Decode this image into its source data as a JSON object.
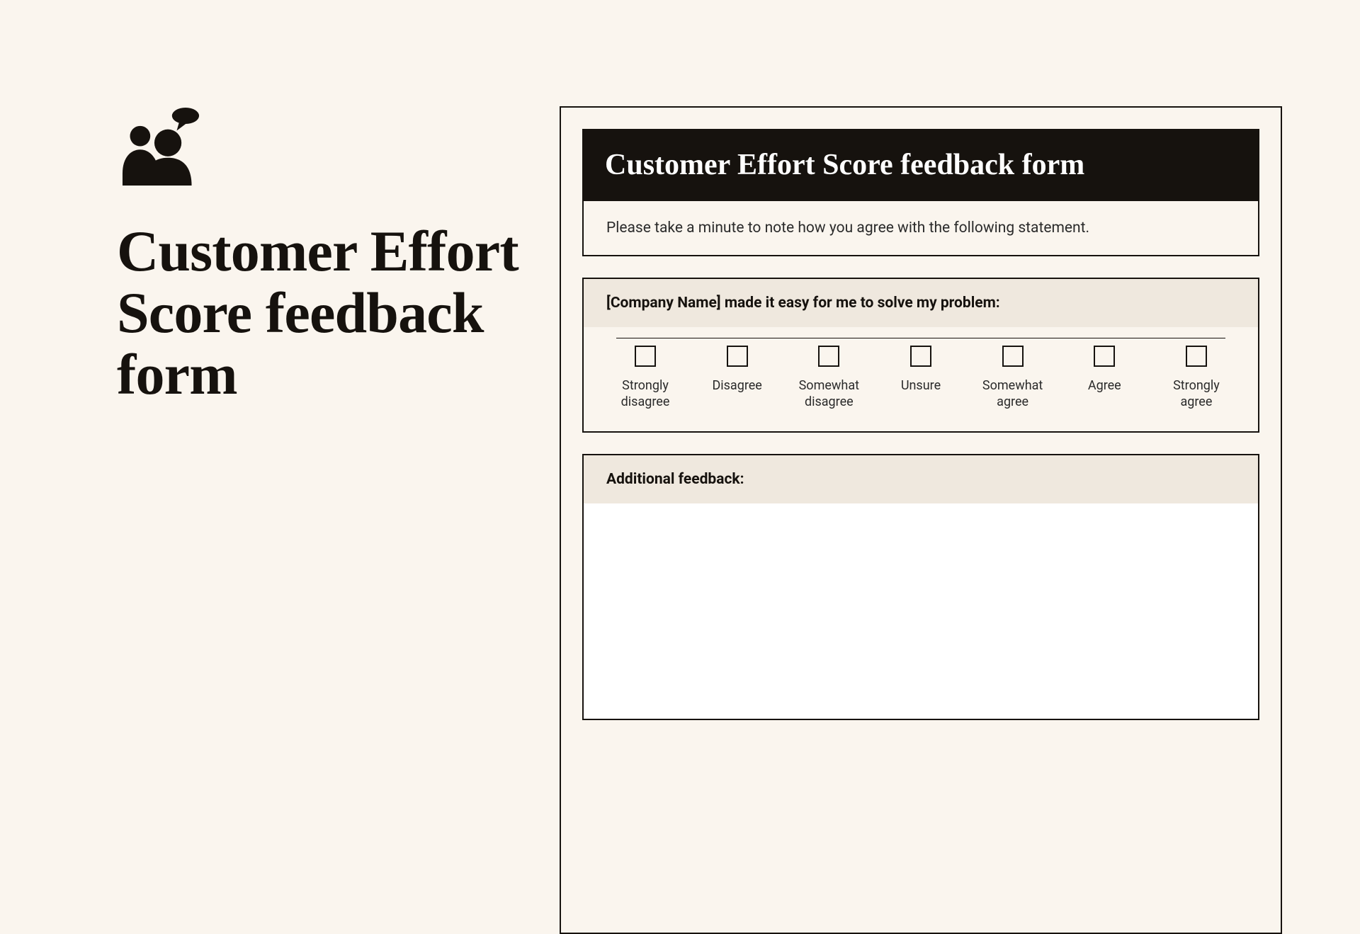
{
  "left": {
    "title": "Customer Effort Score feedback form"
  },
  "form": {
    "header": "Customer Effort Score feedback form",
    "intro": "Please take a minute to note how you agree with the following statement.",
    "question": "[Company Name] made it easy for me to solve my problem:",
    "scale": [
      "Strongly disagree",
      "Disagree",
      "Somewhat disagree",
      "Unsure",
      "Somewhat agree",
      "Agree",
      "Strongly agree"
    ],
    "additional_label": "Additional feedback:",
    "additional_value": ""
  }
}
